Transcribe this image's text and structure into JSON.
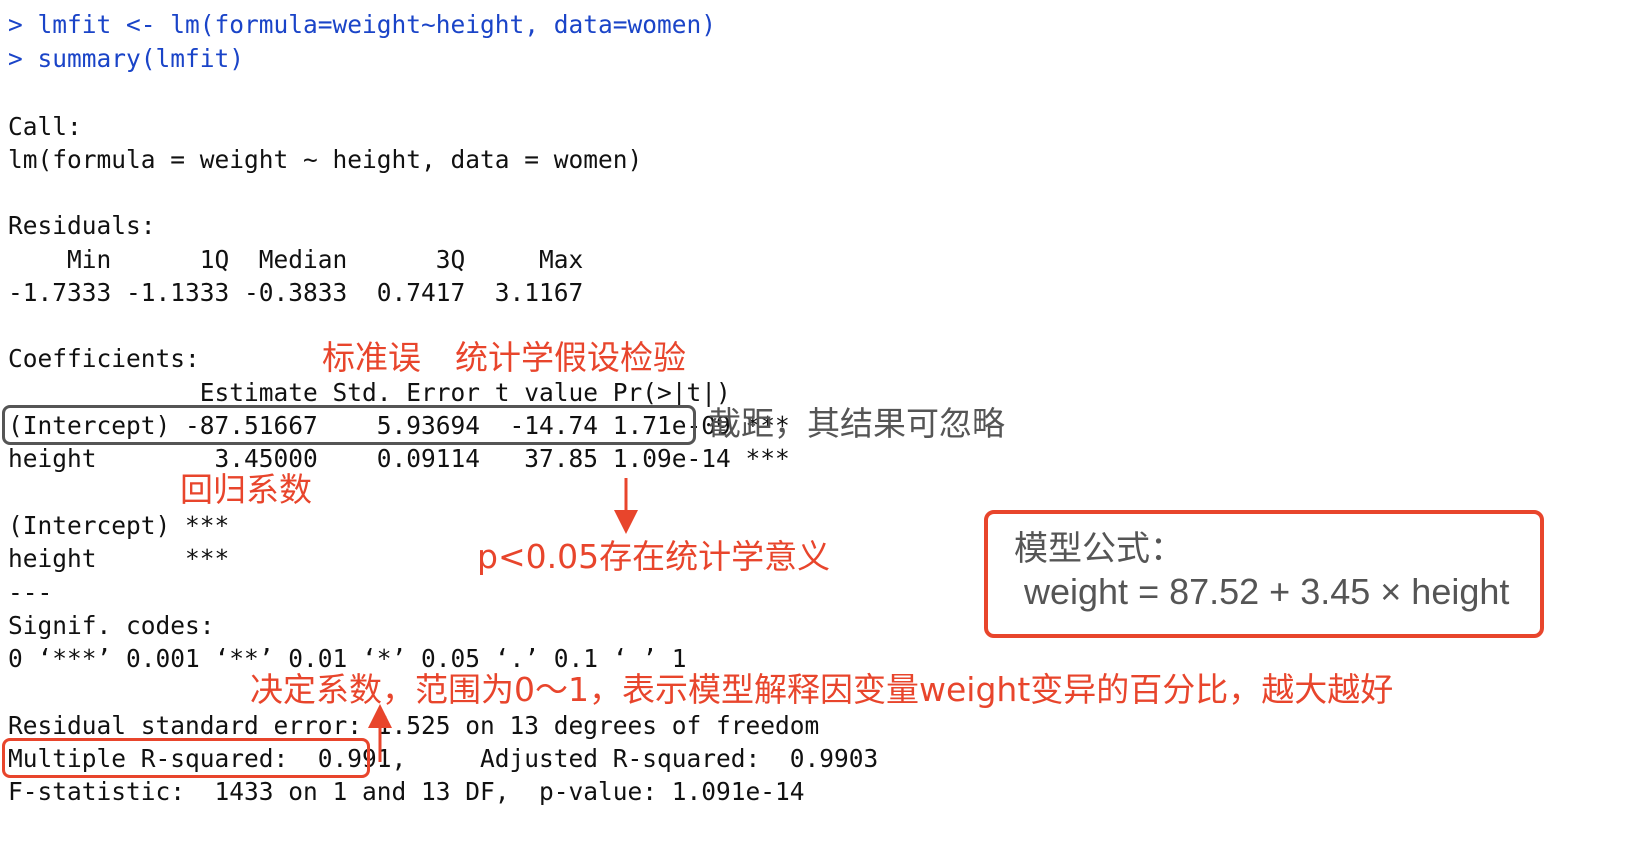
{
  "console": {
    "lines": [
      {
        "type": "cmd",
        "text": "> lmfit <- lm(formula=weight~height, data=women)"
      },
      {
        "type": "cmd",
        "text": "> summary(lmfit)"
      },
      {
        "type": "out",
        "text": ""
      },
      {
        "type": "out",
        "text": "Call:"
      },
      {
        "type": "out",
        "text": "lm(formula = weight ~ height, data = women)"
      },
      {
        "type": "out",
        "text": ""
      },
      {
        "type": "out",
        "text": "Residuals:"
      },
      {
        "type": "out",
        "text": "    Min      1Q  Median      3Q     Max "
      },
      {
        "type": "out",
        "text": "-1.7333 -1.1333 -0.3833  0.7417  3.1167 "
      },
      {
        "type": "out",
        "text": ""
      },
      {
        "type": "out",
        "text": "Coefficients:"
      },
      {
        "type": "out",
        "text": "             Estimate Std. Error t value Pr(>|t|)    "
      },
      {
        "type": "out",
        "text": "(Intercept) -87.51667    5.93694  -14.74 1.71e-09 ***"
      },
      {
        "type": "out",
        "text": "height        3.45000    0.09114   37.85 1.09e-14 ***"
      },
      {
        "type": "out",
        "text": ""
      },
      {
        "type": "out",
        "text": "(Intercept) ***"
      },
      {
        "type": "out",
        "text": "height      ***"
      },
      {
        "type": "out",
        "text": "---"
      },
      {
        "type": "out",
        "text": "Signif. codes:  "
      },
      {
        "type": "out",
        "text": "0 ‘***’ 0.001 ‘**’ 0.01 ‘*’ 0.05 ‘.’ 0.1 ‘ ’ 1"
      },
      {
        "type": "out",
        "text": ""
      },
      {
        "type": "out",
        "text": "Residual standard error: 1.525 on 13 degrees of freedom"
      },
      {
        "type": "out",
        "text": "Multiple R-squared:  0.991,\tAdjusted R-squared:  0.9903 "
      },
      {
        "type": "out",
        "text": "F-statistic:  1433 on 1 and 13 DF,  p-value: 1.091e-14"
      }
    ]
  },
  "annotations": {
    "std_error": "标准误",
    "hypothesis_test": "统计学假设检验",
    "intercept_note": "截距，其结果可忽略",
    "regression_coef": "回归系数",
    "p_value_note": "p<0.05存在统计学意义",
    "r_squared_note": "决定系数，范围为0～1，表示模型解释因变量weight变异的百分比，越大越好"
  },
  "formula_box": {
    "title": "模型公式：",
    "expression": "weight = 87.52 + 3.45 × height"
  },
  "colors": {
    "command": "#1a44c8",
    "output": "#111111",
    "annotation_red": "#e8452c",
    "annotation_gray": "#555555"
  }
}
